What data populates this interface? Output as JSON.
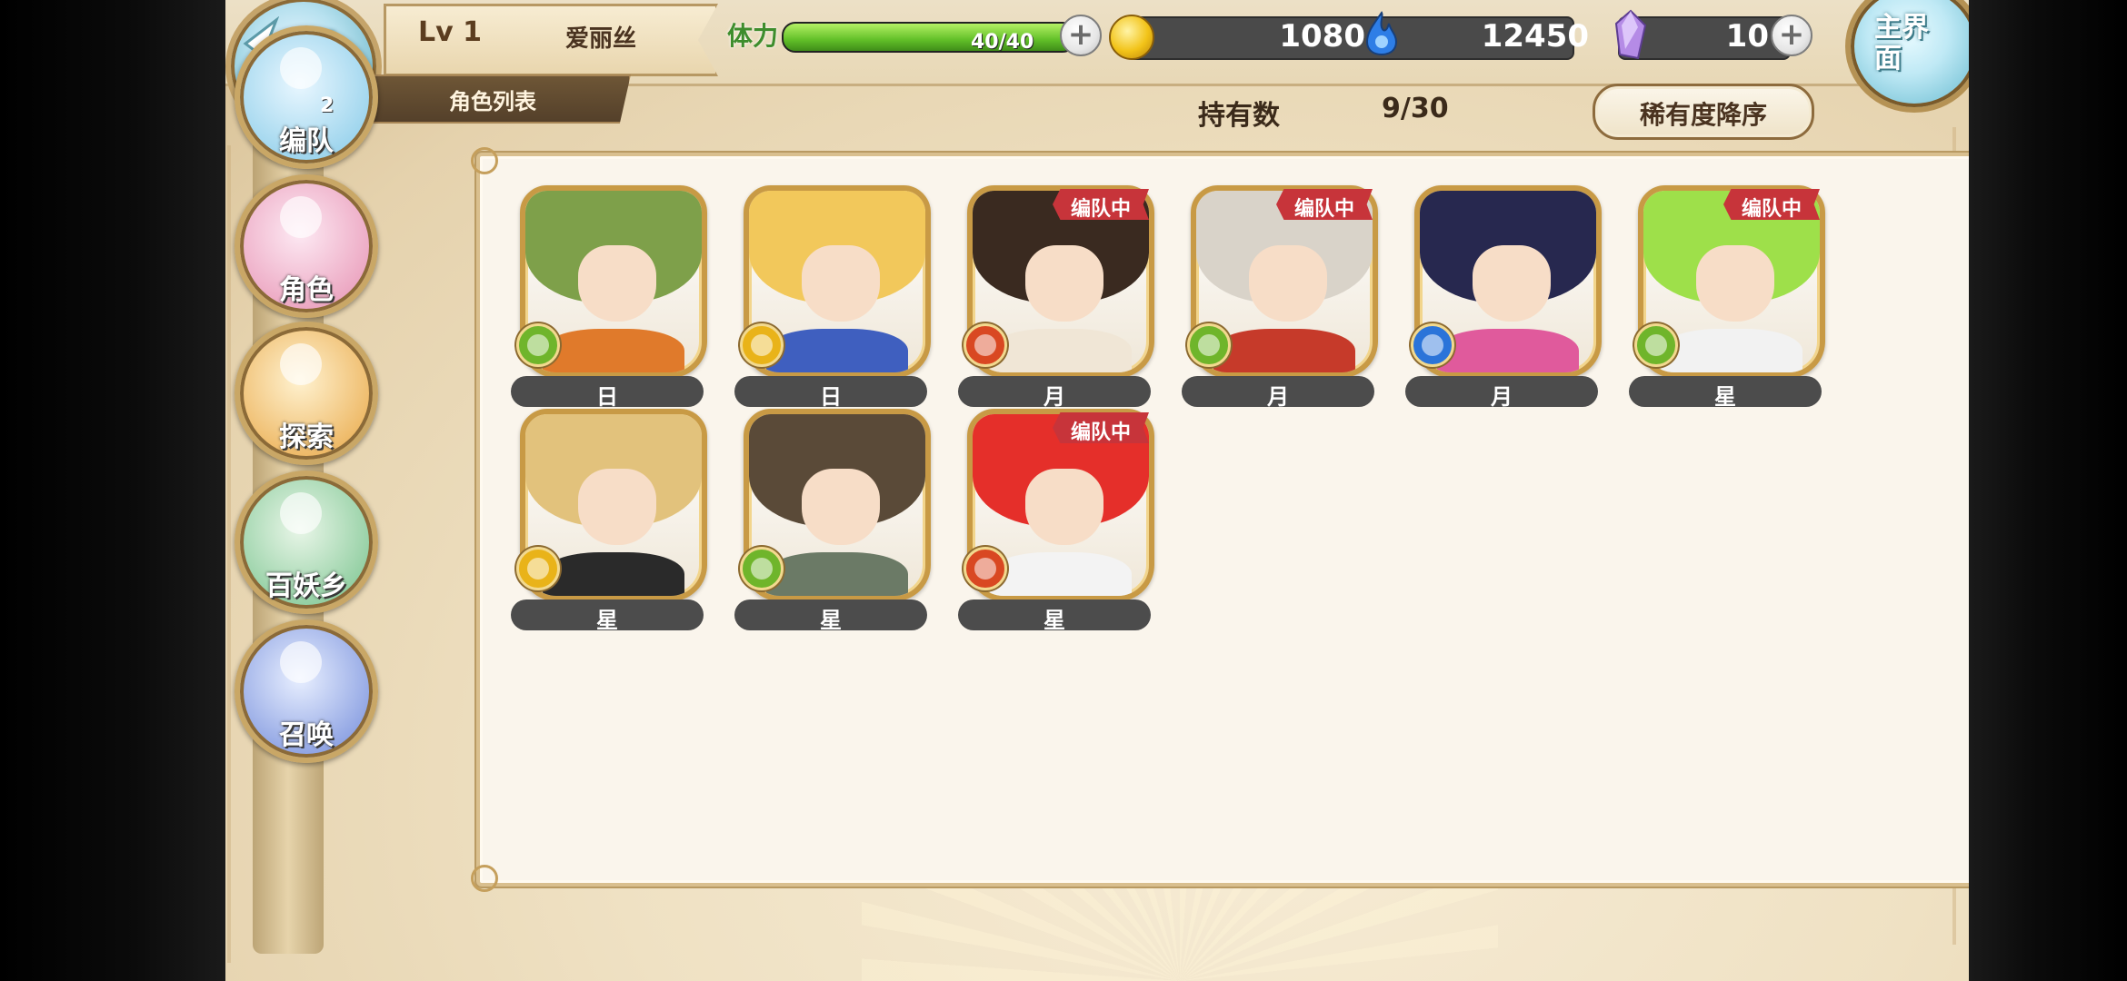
{
  "header": {
    "back_label": "返回",
    "level": "Lv 1",
    "player_name": "爱丽丝",
    "section_title": "角色列表",
    "stamina_label": "体力",
    "stamina_value": "40/40",
    "stamina_fill": 1.0,
    "gold": "1080",
    "soul": "12450",
    "gems": "10",
    "home_label": "主界面"
  },
  "owned": {
    "label": "持有数",
    "value": "9/30"
  },
  "sort": {
    "label": "稀有度降序"
  },
  "nav": [
    {
      "label": "编队",
      "icon": "ghost-icon",
      "badge": "2"
    },
    {
      "label": "角色",
      "icon": "character-icon"
    },
    {
      "label": "探索",
      "icon": "scroll-icon"
    },
    {
      "label": "百妖乡",
      "icon": "village-icon"
    },
    {
      "label": "召唤",
      "icon": "swirl-icon"
    }
  ],
  "team_tag": "编队中",
  "characters": [
    {
      "type": "日",
      "element": "wind",
      "in_team": false,
      "hair": "#7ea04a",
      "element_color": "#6fb52b",
      "accent": "#e07a2b"
    },
    {
      "type": "日",
      "element": "light",
      "in_team": false,
      "hair": "#f2c85b",
      "element_color": "#e9b319",
      "accent": "#3f5fbf"
    },
    {
      "type": "月",
      "element": "fire",
      "in_team": true,
      "hair": "#3a2a20",
      "element_color": "#d94822",
      "accent": "#f0e6d6"
    },
    {
      "type": "月",
      "element": "wind",
      "in_team": true,
      "hair": "#d9d3c9",
      "element_color": "#6fb52b",
      "accent": "#c63a2a"
    },
    {
      "type": "月",
      "element": "water",
      "in_team": false,
      "hair": "#27284f",
      "element_color": "#2b74d9",
      "accent": "#e05a9c"
    },
    {
      "type": "星",
      "element": "wind",
      "in_team": true,
      "hair": "#9ee04a",
      "element_color": "#6fb52b",
      "accent": "#f2f2f2"
    },
    {
      "type": "星",
      "element": "light",
      "in_team": false,
      "hair": "#e2c27c",
      "element_color": "#e9b319",
      "accent": "#2a2a2a"
    },
    {
      "type": "星",
      "element": "wind",
      "in_team": false,
      "hair": "#5a4a38",
      "element_color": "#6fb52b",
      "accent": "#6b7a66"
    },
    {
      "type": "星",
      "element": "fire",
      "in_team": true,
      "hair": "#e52f2a",
      "element_color": "#d94822",
      "accent": "#f3f3f3"
    }
  ]
}
